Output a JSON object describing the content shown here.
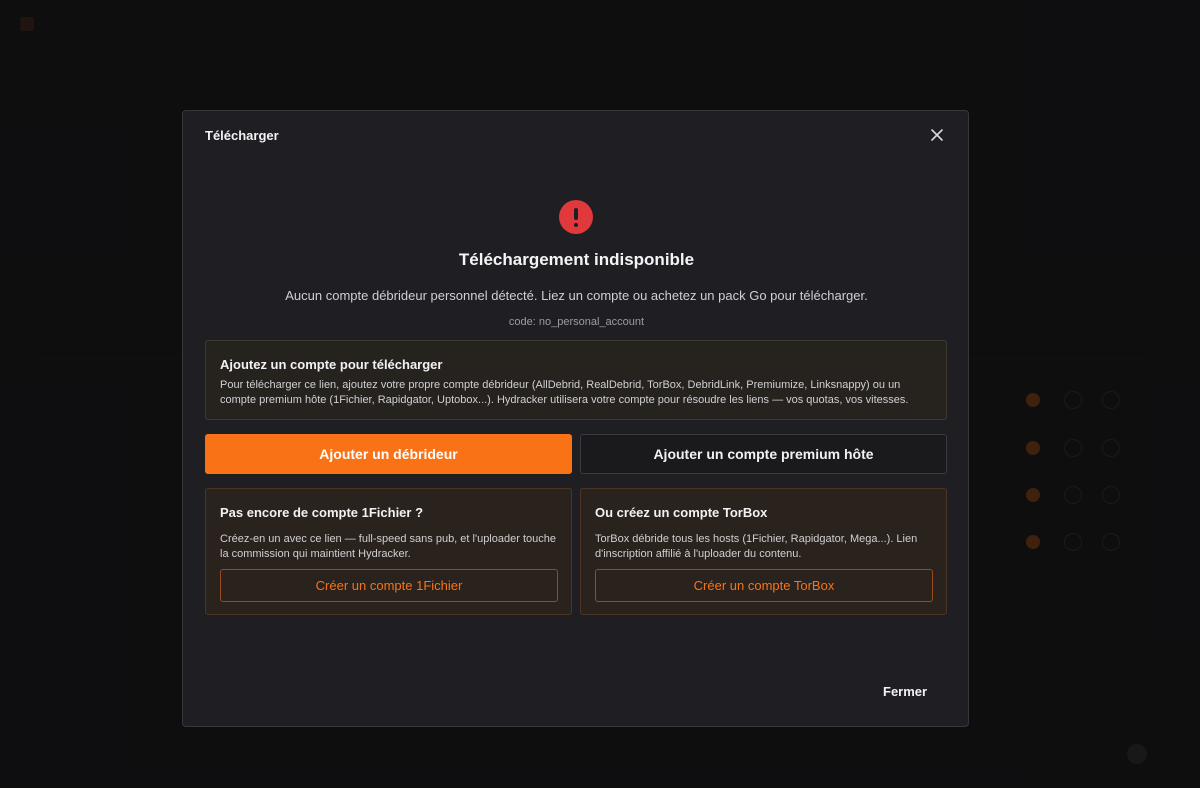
{
  "modal": {
    "title": "Télécharger",
    "heading": "Téléchargement indisponible",
    "message": "Aucun compte débrideur personnel détecté. Liez un compte ou achetez un pack Go pour télécharger.",
    "code_label": "code:",
    "code_value": "no_personal_account",
    "info_box": {
      "title": "Ajoutez un compte pour télécharger",
      "description": "Pour télécharger ce lien, ajoutez votre propre compte débrideur (AllDebrid, RealDebrid, TorBox, DebridLink, Premiumize, Linksnappy) ou un compte premium hôte (1Fichier, Rapidgator, Uptobox...). Hydracker utilisera votre compte pour résoudre les liens — vos quotas, vos vitesses."
    },
    "primary_button": "Ajouter un débrideur",
    "secondary_button": "Ajouter un compte premium hôte",
    "card_left": {
      "title": "Pas encore de compte 1Fichier ?",
      "description": "Créez-en un avec ce lien — full-speed sans pub, et l'uploader touche la commission qui maintient Hydracker.",
      "button": "Créer un compte 1Fichier"
    },
    "card_right": {
      "title": "Ou créez un compte TorBox",
      "description": "TorBox débride tous les hosts (1Fichier, Rapidgator, Mega...). Lien d'inscription affilié à l'uploader du contenu.",
      "button": "Créer un compte TorBox"
    },
    "close_label": "Fermer"
  },
  "colors": {
    "accent": "#f97316",
    "error": "#e0383b",
    "modal_bg": "#1f1f23"
  },
  "icons": {
    "close": "close-icon",
    "error": "exclamation-circle-icon"
  }
}
